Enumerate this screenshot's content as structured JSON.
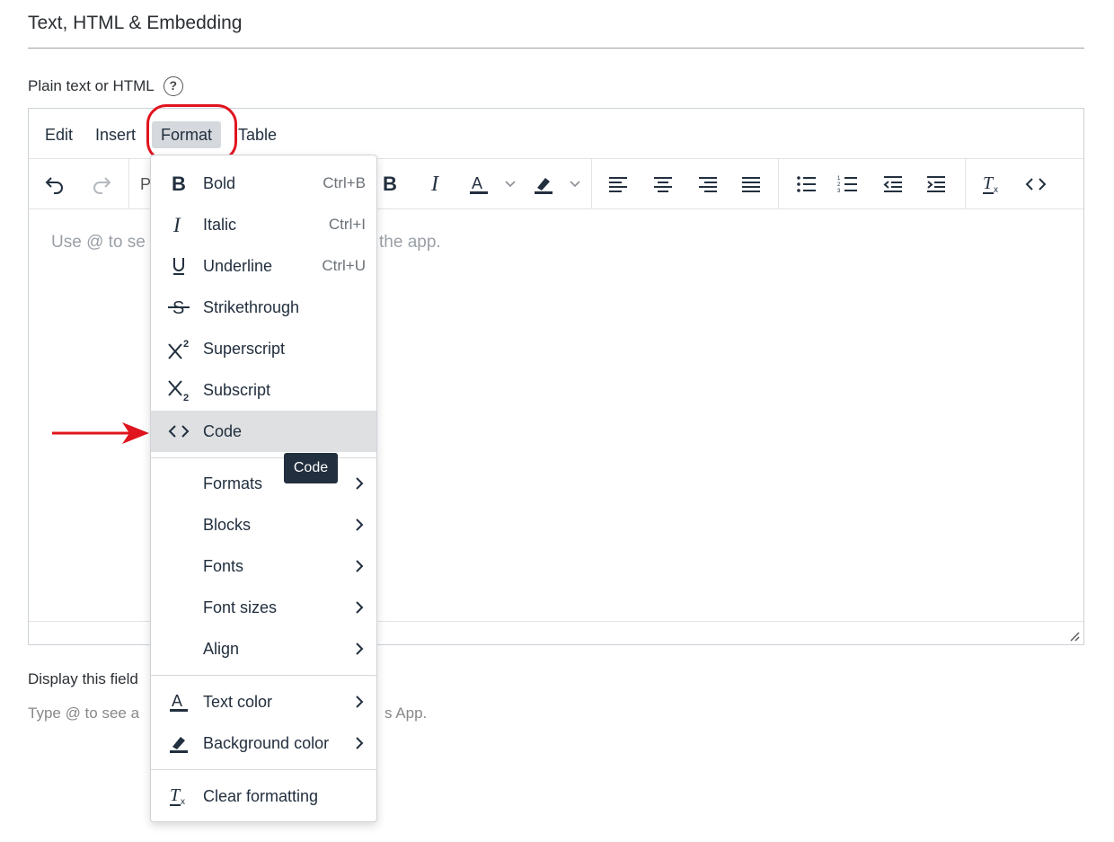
{
  "section": {
    "title": "Text, HTML & Embedding"
  },
  "field": {
    "label": "Plain text or HTML",
    "help_glyph": "?"
  },
  "menubar": {
    "edit": "Edit",
    "insert": "Insert",
    "format": "Format",
    "table": "Table"
  },
  "toolbar": {
    "paragraph_initial": "P",
    "bold_glyph": "B",
    "italic_glyph": "I",
    "text_color_glyph": "A"
  },
  "editor": {
    "placeholder_left": "Use @ to se",
    "placeholder_right": "the app."
  },
  "display": {
    "label": "Display this field",
    "hint_left": "Type @ to see a",
    "hint_right": "s App."
  },
  "format_menu": {
    "items": [
      {
        "label": "Bold",
        "shortcut": "Ctrl+B",
        "icon": "bold-icon"
      },
      {
        "label": "Italic",
        "shortcut": "Ctrl+I",
        "icon": "italic-icon"
      },
      {
        "label": "Underline",
        "shortcut": "Ctrl+U",
        "icon": "underline-icon"
      },
      {
        "label": "Strikethrough",
        "shortcut": "",
        "icon": "strikethrough-icon"
      },
      {
        "label": "Superscript",
        "shortcut": "",
        "icon": "superscript-icon"
      },
      {
        "label": "Subscript",
        "shortcut": "",
        "icon": "subscript-icon"
      },
      {
        "label": "Code",
        "shortcut": "",
        "icon": "code-icon"
      }
    ],
    "submenus": [
      {
        "label": "Formats"
      },
      {
        "label": "Blocks"
      },
      {
        "label": "Fonts"
      },
      {
        "label": "Font sizes"
      },
      {
        "label": "Align"
      }
    ],
    "colors": [
      {
        "label": "Text color",
        "icon": "text-color-icon"
      },
      {
        "label": "Background color",
        "icon": "background-color-icon"
      }
    ],
    "clear": {
      "label": "Clear formatting",
      "icon": "clear-formatting-icon"
    }
  },
  "tooltip": {
    "text": "Code"
  },
  "colors": {
    "highlight": "#e0141e",
    "menu_active": "#dee0e2",
    "tooltip_bg": "#222f3e"
  }
}
